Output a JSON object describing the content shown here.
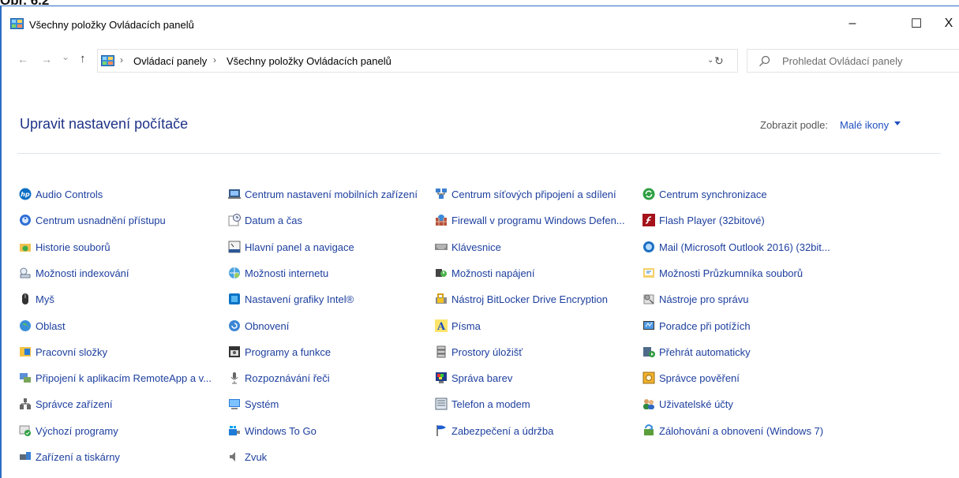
{
  "window": {
    "title": "Všechny položky Ovládacích panelů",
    "minimize_glyph": "–",
    "maximize_glyph": "☐",
    "close_glyph": "X"
  },
  "addressbar": {
    "back_glyph": "←",
    "forward_glyph": "→",
    "recent_glyph": "⌄",
    "up_glyph": "↑",
    "sep1": "›",
    "crumb1": "Ovládací panely",
    "sep2": "›",
    "crumb2": "Všechny položky Ovládacích panelů",
    "dropdown_glyph": "⌄",
    "refresh_glyph": "↻",
    "search_placeholder": "Prohledat Ovládací panely"
  },
  "main": {
    "heading": "Upravit nastavení počítače",
    "view_label": "Zobrazit podle:",
    "view_value": "Malé ikony"
  },
  "columns": [
    [
      {
        "label": "Audio Controls",
        "icon": "hp-icon"
      },
      {
        "label": "Centrum usnadnění přístupu",
        "icon": "ease-of-access-icon"
      },
      {
        "label": "Historie souborů",
        "icon": "file-history-icon"
      },
      {
        "label": "Možnosti indexování",
        "icon": "indexing-icon"
      },
      {
        "label": "Myš",
        "icon": "mouse-icon"
      },
      {
        "label": "Oblast",
        "icon": "region-icon"
      },
      {
        "label": "Pracovní složky",
        "icon": "work-folders-icon"
      },
      {
        "label": "Připojení k aplikacím RemoteApp a v...",
        "icon": "remoteapp-icon"
      },
      {
        "label": "Správce zařízení",
        "icon": "device-manager-icon"
      },
      {
        "label": "Výchozí programy",
        "icon": "default-programs-icon"
      },
      {
        "label": "Zařízení a tiskárny",
        "icon": "devices-printers-icon"
      }
    ],
    [
      {
        "label": "Centrum nastavení mobilních zařízení",
        "icon": "mobility-center-icon"
      },
      {
        "label": "Datum a čas",
        "icon": "date-time-icon"
      },
      {
        "label": "Hlavní panel a navigace",
        "icon": "taskbar-icon"
      },
      {
        "label": "Možnosti internetu",
        "icon": "internet-options-icon"
      },
      {
        "label": "Nastavení grafiky Intel®",
        "icon": "intel-graphics-icon"
      },
      {
        "label": "Obnovení",
        "icon": "recovery-icon"
      },
      {
        "label": "Programy a funkce",
        "icon": "programs-features-icon"
      },
      {
        "label": "Rozpoznávání řeči",
        "icon": "speech-recognition-icon"
      },
      {
        "label": "Systém",
        "icon": "system-icon"
      },
      {
        "label": "Windows To Go",
        "icon": "windows-to-go-icon"
      },
      {
        "label": "Zvuk",
        "icon": "sound-icon"
      }
    ],
    [
      {
        "label": "Centrum síťových připojení a sdílení",
        "icon": "network-center-icon"
      },
      {
        "label": "Firewall v programu Windows Defen...",
        "icon": "firewall-icon"
      },
      {
        "label": "Klávesnice",
        "icon": "keyboard-icon"
      },
      {
        "label": "Možnosti napájení",
        "icon": "power-options-icon"
      },
      {
        "label": "Nástroj BitLocker Drive Encryption",
        "icon": "bitlocker-icon"
      },
      {
        "label": "Písma",
        "icon": "fonts-icon"
      },
      {
        "label": "Prostory úložišť",
        "icon": "storage-spaces-icon"
      },
      {
        "label": "Správa barev",
        "icon": "color-management-icon"
      },
      {
        "label": "Telefon a modem",
        "icon": "phone-modem-icon"
      },
      {
        "label": "Zabezpečení a údržba",
        "icon": "security-maintenance-icon"
      }
    ],
    [
      {
        "label": "Centrum synchronizace",
        "icon": "sync-center-icon"
      },
      {
        "label": "Flash Player (32bitové)",
        "icon": "flash-player-icon"
      },
      {
        "label": "Mail (Microsoft Outlook 2016) (32bit...",
        "icon": "mail-icon"
      },
      {
        "label": "Možnosti Průzkumníka souborů",
        "icon": "file-explorer-options-icon"
      },
      {
        "label": "Nástroje pro správu",
        "icon": "admin-tools-icon"
      },
      {
        "label": "Poradce při potížích",
        "icon": "troubleshooting-icon"
      },
      {
        "label": "Přehrát automaticky",
        "icon": "autoplay-icon"
      },
      {
        "label": "Správce pověření",
        "icon": "credential-manager-icon"
      },
      {
        "label": "Uživatelské účty",
        "icon": "user-accounts-icon"
      },
      {
        "label": "Zálohování a obnovení (Windows 7)",
        "icon": "backup-restore-icon"
      }
    ]
  ]
}
